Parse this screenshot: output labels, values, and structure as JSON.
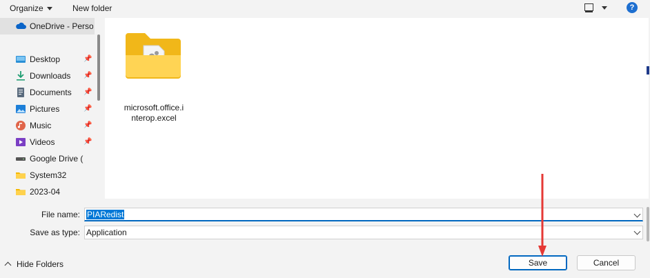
{
  "toolbar": {
    "organize_label": "Organize",
    "new_folder_label": "New folder",
    "help_label": "?"
  },
  "nav": {
    "onedrive_label": "OneDrive - Person",
    "items": [
      {
        "label": "Desktop",
        "icon": "desktop-icon",
        "pinned": true
      },
      {
        "label": "Downloads",
        "icon": "download-icon",
        "pinned": true
      },
      {
        "label": "Documents",
        "icon": "document-icon",
        "pinned": true
      },
      {
        "label": "Pictures",
        "icon": "pictures-icon",
        "pinned": true
      },
      {
        "label": "Music",
        "icon": "music-icon",
        "pinned": true
      },
      {
        "label": "Videos",
        "icon": "videos-icon",
        "pinned": true
      },
      {
        "label": "Google Drive (",
        "icon": "drive-icon",
        "pinned": false
      },
      {
        "label": "System32",
        "icon": "folder-icon",
        "pinned": false
      },
      {
        "label": "2023-04",
        "icon": "folder-icon",
        "pinned": false
      }
    ]
  },
  "content": {
    "items": [
      {
        "label": "microsoft.office.interop.excel"
      }
    ]
  },
  "form": {
    "file_name_label": "File name:",
    "file_name_value": "PIARedist",
    "save_type_label": "Save as type:",
    "save_type_value": "Application"
  },
  "footer": {
    "hide_folders_label": "Hide Folders",
    "save_label": "Save",
    "cancel_label": "Cancel"
  },
  "colors": {
    "accent": "#0067c0",
    "selection": "#0078d7",
    "annotation_arrow": "#e53935",
    "folder_yellow": "#f7c948"
  }
}
